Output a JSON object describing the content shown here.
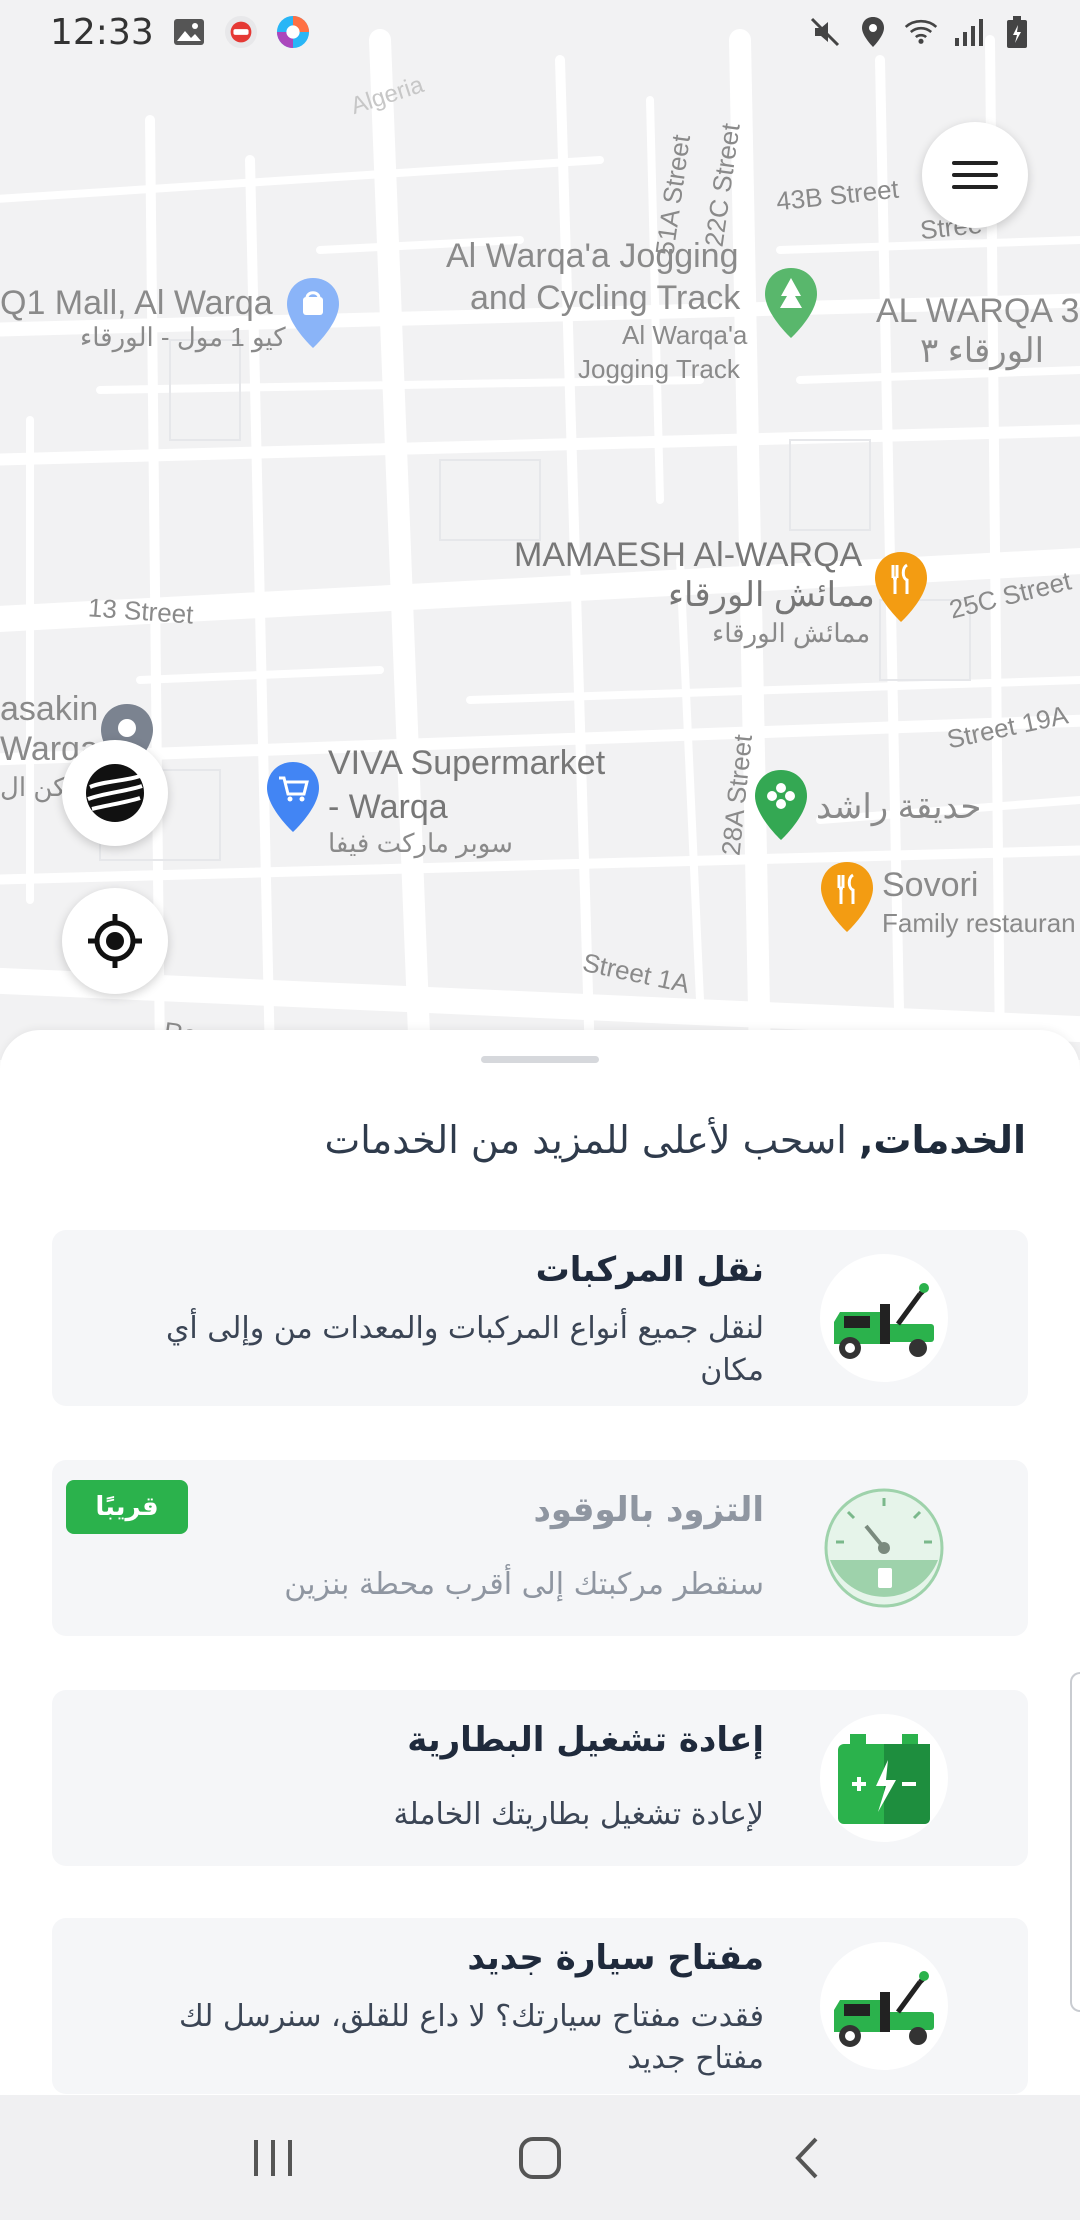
{
  "status_bar": {
    "time": "12:33",
    "left_icons": [
      "gallery-icon",
      "app-icon-red",
      "app-icon-colorful"
    ],
    "right_icons": [
      "mute-icon",
      "location-icon",
      "wifi-icon",
      "signal-icon",
      "battery-icon"
    ]
  },
  "map": {
    "labels": {
      "algeria": "Algeria",
      "street_51a": "51A Street",
      "street_22c": "22C Street",
      "street_43b": "43B Street",
      "street_edge": "Stree",
      "q1_mall": "Q1 Mall, Al Warqa",
      "q1_mall_ar": "كيو 1 مول - الورقاء",
      "jogging_en_1": "Al Warqa'a Jogging",
      "jogging_en_2": "and Cycling Track",
      "jogging_sub_1": "Al Warqa'a",
      "jogging_sub_2": "Jogging Track",
      "warqa3_en": "AL WARQA 3",
      "warqa3_ar": "الورقاء ٣",
      "mamaesh_en": "MAMAESH Al-WARQA",
      "mamaesh_ar_1": "ممائش الورقاء",
      "mamaesh_ar_2": "ممائش الورقاء",
      "street_25c": "25C Street",
      "street_13": "13 Street",
      "masakin_1": "asakin",
      "masakin_2": "Warqa",
      "masakin_3": "مكن ال",
      "street_19a": "Street 19A",
      "viva_1": "VIVA Supermarket",
      "viva_2": "- Warqa",
      "viva_ar": "سوبر ماركت فيفا",
      "street_28a": "28A Street",
      "rashid_park": "حديقة راشد",
      "sovori": "Sovori",
      "sovori_sub": "Family restauran",
      "street_1a": "Street 1A",
      "re": "Re"
    }
  },
  "controls": {
    "menu_icon": "hamburger-menu-icon",
    "globe_icon": "globe-icon",
    "locate_icon": "my-location-icon"
  },
  "sheet": {
    "header_bold": "الخدمات,",
    "header_rest": " اسحب لأعلى للمزيد من الخدمات",
    "cards": [
      {
        "title": "نقل المركبات",
        "desc": "لنقل جميع أنواع المركبات والمعدات من وإلى أي مكان",
        "icon": "tow-truck-icon",
        "enabled": true
      },
      {
        "title": "التزود بالوقود",
        "desc": "سنقطر مركبتك إلى أقرب محطة بنزين",
        "icon": "fuel-gauge-icon",
        "badge": "قريبًا",
        "enabled": false
      },
      {
        "title": "إعادة تشغيل البطارية",
        "desc": "لإعادة تشغيل بطاريتك الخاملة",
        "icon": "battery-icon",
        "enabled": true
      },
      {
        "title": "مفتاح سيارة جديد",
        "desc": "فقدت مفتاح سيارتك؟ لا داع للقلق، سنرسل لك مفتاح جديد",
        "icon": "tow-truck-icon",
        "enabled": true
      }
    ]
  },
  "navbar": {
    "recent_icon": "recent-apps-icon",
    "home_icon": "home-icon",
    "back_icon": "back-icon"
  },
  "colors": {
    "accent_green": "#2bb24c",
    "title_dark": "#1f2a3c",
    "card_bg": "#f5f6f8",
    "map_bg": "#f2f2f3"
  }
}
